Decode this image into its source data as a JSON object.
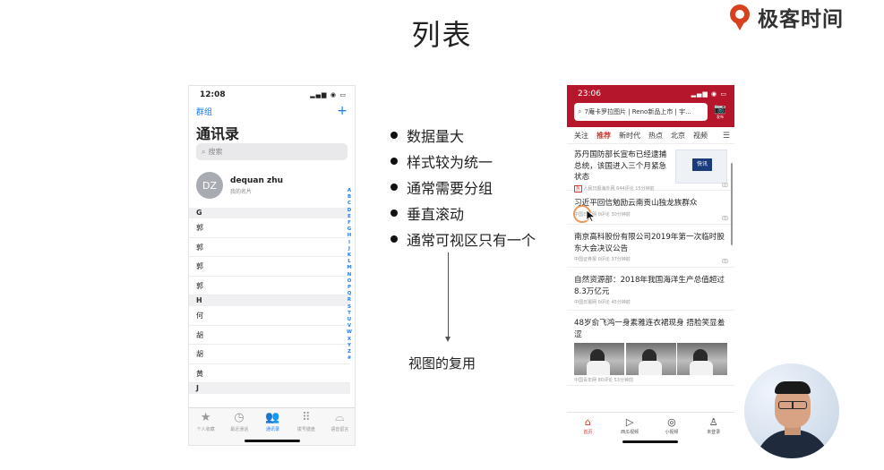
{
  "slide": {
    "title": "列表",
    "brand": "极客时间",
    "accent": "#d8411e"
  },
  "contacts_app": {
    "status_time": "12:08",
    "nav_left": "群组",
    "nav_right": "+",
    "title": "通讯录",
    "search_placeholder": "搜索",
    "me": {
      "initials": "DZ",
      "name": "dequan zhu",
      "subtitle": "我的名片"
    },
    "sections": [
      {
        "letter": "G",
        "rows": [
          "郭",
          "郭",
          "郭",
          "郭"
        ]
      },
      {
        "letter": "H",
        "rows": [
          "何",
          "胡",
          "胡",
          "黄"
        ]
      },
      {
        "letter": "J",
        "rows": []
      }
    ],
    "index_letters": [
      "A",
      "B",
      "C",
      "D",
      "E",
      "F",
      "G",
      "H",
      "I",
      "J",
      "K",
      "L",
      "M",
      "N",
      "O",
      "P",
      "Q",
      "R",
      "S",
      "T",
      "U",
      "V",
      "W",
      "X",
      "Y",
      "Z",
      "#"
    ],
    "tabs": [
      {
        "label": "个人收藏",
        "icon": "star-icon",
        "active": false
      },
      {
        "label": "最近通话",
        "icon": "clock-icon",
        "active": false
      },
      {
        "label": "通讯录",
        "icon": "contacts-icon",
        "active": true
      },
      {
        "label": "拨号键盘",
        "icon": "keypad-icon",
        "active": false
      },
      {
        "label": "语音留言",
        "icon": "voicemail-icon",
        "active": false
      }
    ],
    "accent": "#1e7cf5"
  },
  "bullets": [
    "数据量大",
    "样式较为统一",
    "通常需要分组",
    "垂直滚动",
    "通常可视区只有一个"
  ],
  "arrow_caption": "视图的复用",
  "news_app": {
    "status_time": "23:06",
    "search_text": "7庵卡罗拉图片 | Reno新品上市 | 宇...",
    "publish_label": "发布",
    "channels": [
      "关注",
      "推荐",
      "新时代",
      "热点",
      "北京",
      "视频"
    ],
    "active_channel": 1,
    "menu_icon": "☰",
    "articles": [
      {
        "title": "苏丹国防部长宣布已经逮捕总统，该国进入三个月紧急状态",
        "source": "人民日报海外网",
        "comments": "644评论",
        "time": "15分钟前",
        "tag": "热",
        "thumb": "快讯"
      },
      {
        "title": "习近平回信勉励云南贡山独龙族群众",
        "source": "中国日报网",
        "comments": "0评论",
        "time": "30分钟前"
      },
      {
        "title": "南京高科股份有限公司2019年第一次临时股东大会决议公告",
        "source": "中国证券报",
        "comments": "0评论",
        "time": "37分钟前"
      },
      {
        "title": "自然资源部：2018年我国海洋生产总值超过8.3万亿元",
        "source": "中国日报网",
        "comments": "0评论",
        "time": "45分钟前"
      },
      {
        "title": "48岁俞飞鸿一身素雅连衣裙现身 捂脸笑显羞涩",
        "source": "中国青年网",
        "comments": "80评论",
        "time": "53分钟前"
      }
    ],
    "tabs": [
      {
        "label": "首页",
        "icon": "home-icon",
        "active": true
      },
      {
        "label": "西瓜视频",
        "icon": "play-icon",
        "active": false
      },
      {
        "label": "小视频",
        "icon": "small-video-icon",
        "active": false
      },
      {
        "label": "未登录",
        "icon": "user-icon",
        "active": false
      }
    ],
    "header_color": "#b5162b",
    "accent": "#d33a31"
  }
}
